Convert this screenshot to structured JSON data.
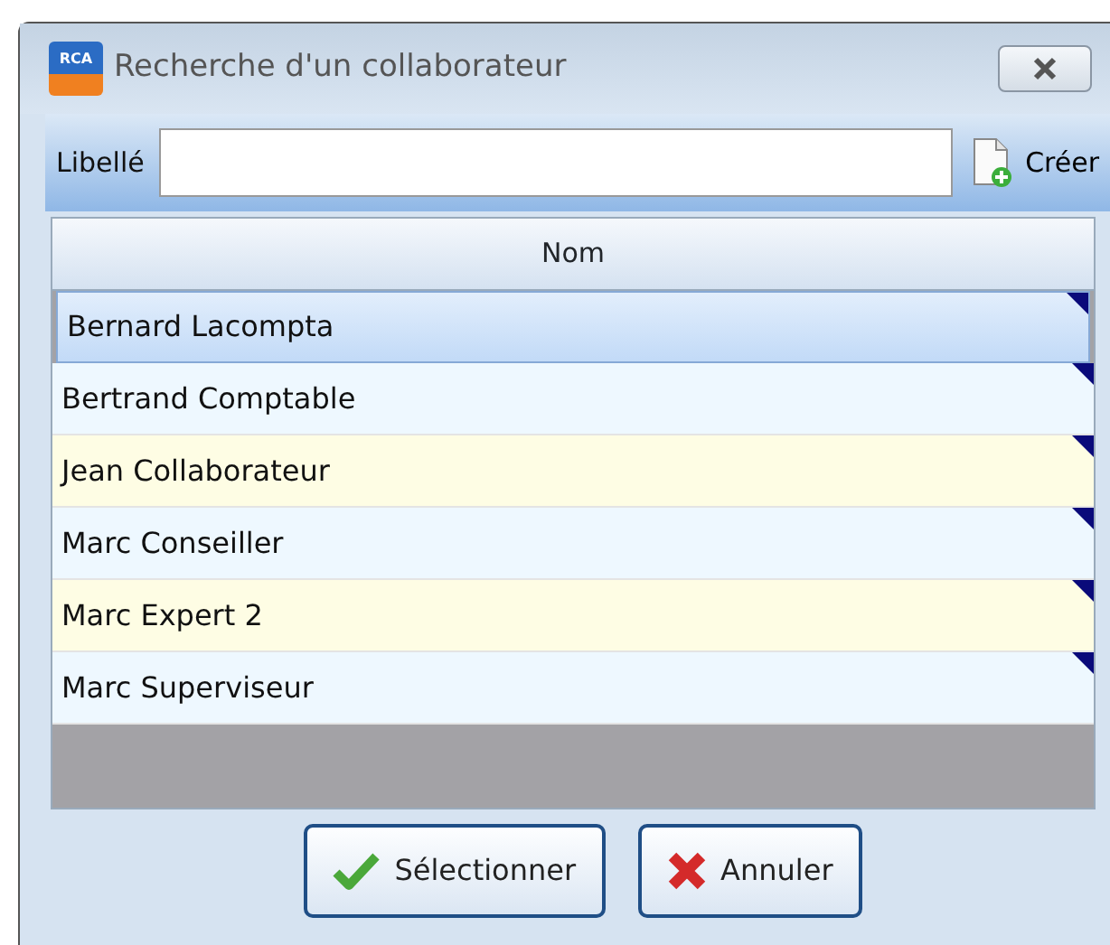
{
  "window": {
    "title": "Recherche d'un collaborateur",
    "logo": "RCA"
  },
  "toolbar": {
    "label": "Libellé",
    "create_button": "Créer"
  },
  "table": {
    "columns": [
      "Nom"
    ],
    "rows": [
      {
        "name": "Bernard Lacompta",
        "selected": true
      },
      {
        "name": "Bertrand Comptable",
        "selected": false
      },
      {
        "name": "Jean Collaborateur",
        "selected": false
      },
      {
        "name": "Marc Conseiller",
        "selected": false
      },
      {
        "name": "Marc Expert 2",
        "selected": false
      },
      {
        "name": "Marc Superviseur",
        "selected": false
      }
    ]
  },
  "buttons": [
    {
      "label": "Sélectionner",
      "kind": "ok"
    },
    {
      "label": "Annuler",
      "kind": "cancel"
    }
  ]
}
